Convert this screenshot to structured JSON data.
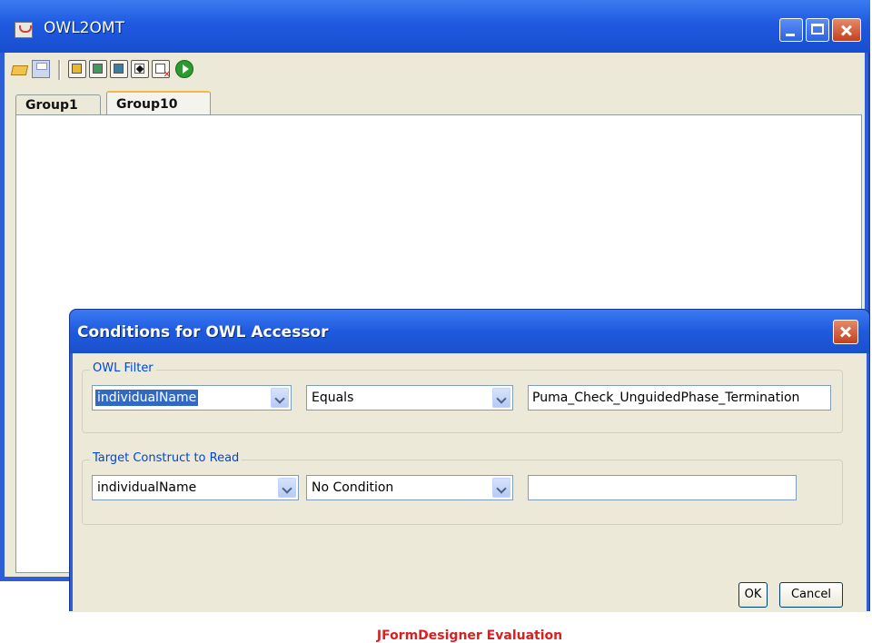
{
  "window": {
    "title": "OWL2OMT",
    "controls": [
      "minimize",
      "maximize",
      "close"
    ]
  },
  "toolbar": {
    "icons": [
      "open-folder-icon",
      "save-icon",
      "add-group-icon",
      "group-icon",
      "group-icon",
      "add-condition-icon",
      "delete-icon",
      "run-icon"
    ]
  },
  "tabs": [
    {
      "label": "Group1",
      "selected": false
    },
    {
      "label": "Group10",
      "selected": true
    }
  ],
  "dialog": {
    "title": "Conditions for OWL Accessor",
    "owl_filter": {
      "legend": "OWL Filter",
      "property": "individualName",
      "operator": "Equals",
      "value": "Puma_Check_UnguidedPhase_Termination"
    },
    "target": {
      "legend": "Target Construct to Read",
      "property": "individualName",
      "operator": "No Condition",
      "value": ""
    },
    "ok_label": "OK",
    "cancel_label": "Cancel",
    "evaluation_notice": "JFormDesigner Evaluation"
  },
  "colors": {
    "title_bar": "#2d5ed8",
    "dialog_face": "#ece9d8",
    "legend_text": "#0046d5",
    "evaluation_text": "#d82020",
    "selection": "#316ac5"
  }
}
